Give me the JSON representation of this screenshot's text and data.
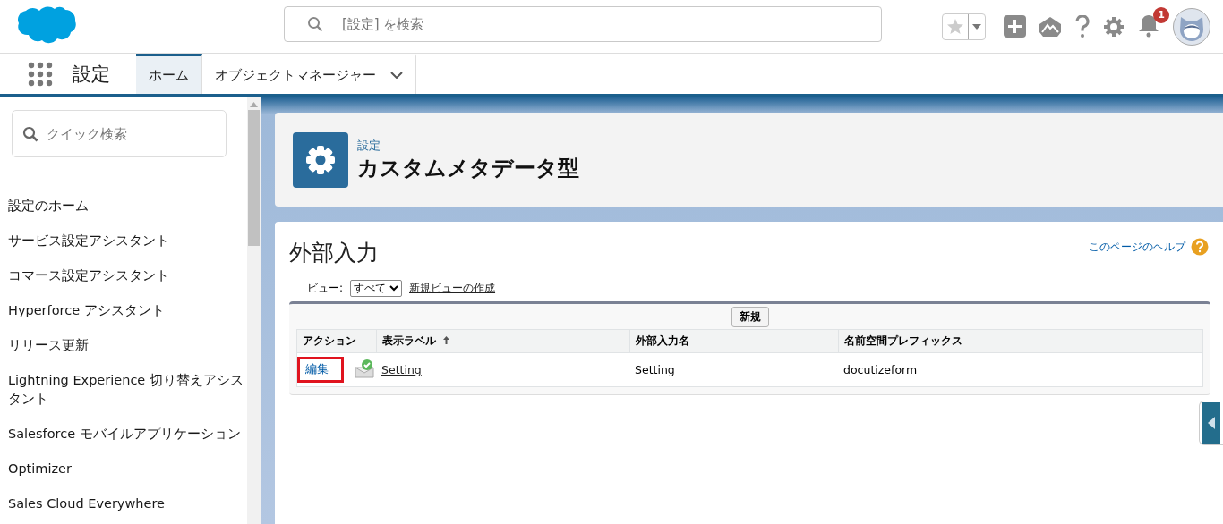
{
  "header": {
    "search_placeholder": "[設定] を検索",
    "notification_count": "1"
  },
  "nav": {
    "app_name": "設定",
    "tabs": [
      {
        "label": "ホーム",
        "selected": true,
        "has_menu": false
      },
      {
        "label": "オブジェクトマネージャー",
        "selected": false,
        "has_menu": true
      }
    ]
  },
  "sidebar": {
    "search_placeholder": "クイック検索",
    "items": [
      {
        "label": "設定のホーム"
      },
      {
        "label": "サービス設定アシスタント"
      },
      {
        "label": "コマース設定アシスタント"
      },
      {
        "label": "Hyperforce アシスタント"
      },
      {
        "label": "リリース更新"
      },
      {
        "label": "Lightning Experience 切り替えアシスタント"
      },
      {
        "label": "Salesforce モバイルアプリケーション"
      },
      {
        "label": "Optimizer"
      },
      {
        "label": "Sales Cloud Everywhere"
      }
    ]
  },
  "page_header": {
    "breadcrumb": "設定",
    "title": "カスタムメタデータ型"
  },
  "content": {
    "title": "外部入力",
    "help_link": "このページのヘルプ",
    "view_label": "ビュー:",
    "view_value": "すべて",
    "new_view_link": "新規ビューの作成",
    "new_button": "新規",
    "table": {
      "columns": [
        {
          "label": "アクション",
          "sorted": false
        },
        {
          "label": "表示ラベル",
          "sorted": true
        },
        {
          "label": "外部入力名",
          "sorted": false
        },
        {
          "label": "名前空間プレフィックス",
          "sorted": false
        }
      ],
      "rows": [
        {
          "action": "編集",
          "action_highlighted": true,
          "label": "Setting",
          "name": "Setting",
          "namespace": "docutizeform"
        }
      ]
    }
  }
}
